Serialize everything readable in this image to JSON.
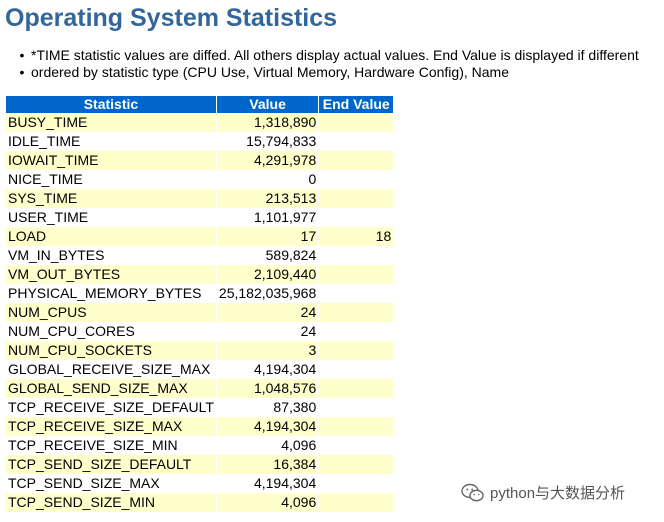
{
  "page": {
    "title": "Operating System Statistics",
    "notes": [
      "*TIME statistic values are diffed. All others display actual values. End Value is displayed if different",
      "ordered by statistic type (CPU Use, Virtual Memory, Hardware Config), Name"
    ]
  },
  "table": {
    "headers": [
      "Statistic",
      "Value",
      "End Value"
    ],
    "rows": [
      {
        "name": "BUSY_TIME",
        "value": "1,318,890",
        "end": ""
      },
      {
        "name": "IDLE_TIME",
        "value": "15,794,833",
        "end": ""
      },
      {
        "name": "IOWAIT_TIME",
        "value": "4,291,978",
        "end": ""
      },
      {
        "name": "NICE_TIME",
        "value": "0",
        "end": ""
      },
      {
        "name": "SYS_TIME",
        "value": "213,513",
        "end": ""
      },
      {
        "name": "USER_TIME",
        "value": "1,101,977",
        "end": ""
      },
      {
        "name": "LOAD",
        "value": "17",
        "end": "18"
      },
      {
        "name": "VM_IN_BYTES",
        "value": "589,824",
        "end": ""
      },
      {
        "name": "VM_OUT_BYTES",
        "value": "2,109,440",
        "end": ""
      },
      {
        "name": "PHYSICAL_MEMORY_BYTES",
        "value": "25,182,035,968",
        "end": ""
      },
      {
        "name": "NUM_CPUS",
        "value": "24",
        "end": ""
      },
      {
        "name": "NUM_CPU_CORES",
        "value": "24",
        "end": ""
      },
      {
        "name": "NUM_CPU_SOCKETS",
        "value": "3",
        "end": ""
      },
      {
        "name": "GLOBAL_RECEIVE_SIZE_MAX",
        "value": "4,194,304",
        "end": ""
      },
      {
        "name": "GLOBAL_SEND_SIZE_MAX",
        "value": "1,048,576",
        "end": ""
      },
      {
        "name": "TCP_RECEIVE_SIZE_DEFAULT",
        "value": "87,380",
        "end": ""
      },
      {
        "name": "TCP_RECEIVE_SIZE_MAX",
        "value": "4,194,304",
        "end": ""
      },
      {
        "name": "TCP_RECEIVE_SIZE_MIN",
        "value": "4,096",
        "end": ""
      },
      {
        "name": "TCP_SEND_SIZE_DEFAULT",
        "value": "16,384",
        "end": ""
      },
      {
        "name": "TCP_SEND_SIZE_MAX",
        "value": "4,194,304",
        "end": ""
      },
      {
        "name": "TCP_SEND_SIZE_MIN",
        "value": "4,096",
        "end": ""
      }
    ]
  },
  "watermark": {
    "text": "python与大数据分析",
    "icon": "wechat-icon"
  },
  "colors": {
    "title": "#336699",
    "header_bg": "#0066cc",
    "row_highlight": "#ffffcc"
  }
}
